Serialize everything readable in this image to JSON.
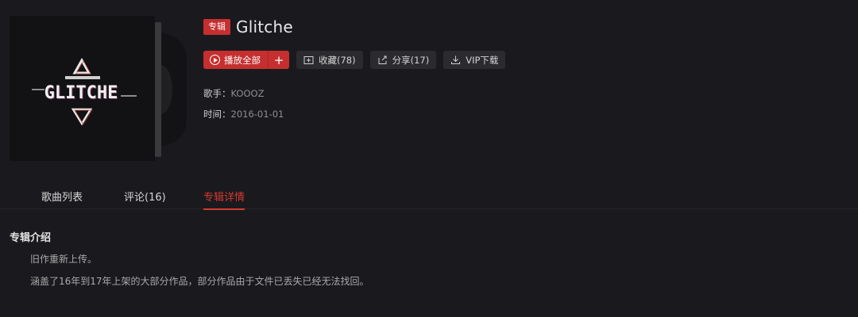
{
  "album": {
    "tag": "专辑",
    "title": "Glitche",
    "cover_text": "GLITCHE"
  },
  "actions": {
    "play_all": "播放全部",
    "add": "+",
    "collect": "收藏(78)",
    "share": "分享(17)",
    "vip_download": "VIP下载"
  },
  "meta": {
    "singer_label": "歌手：",
    "singer": "KOOOZ",
    "time_label": "时间：",
    "time": "2016-01-01"
  },
  "tabs": [
    {
      "label": "歌曲列表",
      "active": false
    },
    {
      "label": "评论(16)",
      "active": false
    },
    {
      "label": "专辑详情",
      "active": true
    }
  ],
  "description": {
    "title": "专辑介绍",
    "lines": [
      "旧作重新上传。",
      "涵盖了16年到17年上架的大部分作品，部分作品由于文件已丢失已经无法找回。"
    ]
  },
  "colors": {
    "accent": "#c62f2f",
    "background": "#1a1a1e"
  }
}
